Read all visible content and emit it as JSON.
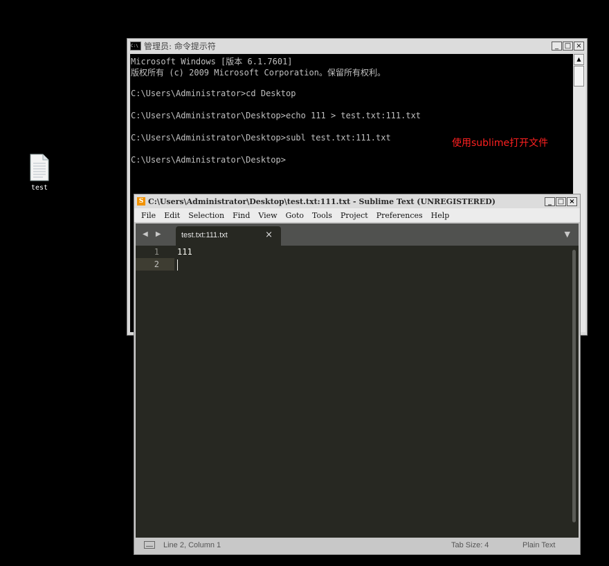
{
  "desktop": {
    "icon_label": "test"
  },
  "cmd": {
    "title": "管理员: 命令提示符",
    "icon_text": "C:\\",
    "lines": [
      "Microsoft Windows [版本 6.1.7601]",
      "版权所有 (c) 2009 Microsoft Corporation。保留所有权利。",
      "",
      "C:\\Users\\Administrator>cd Desktop",
      "",
      "C:\\Users\\Administrator\\Desktop>echo 111 > test.txt:111.txt",
      "",
      "C:\\Users\\Administrator\\Desktop>subl test.txt:111.txt",
      "",
      "C:\\Users\\Administrator\\Desktop>"
    ],
    "annotation": "使用sublime打开文件",
    "annotation_color": "#ff2020",
    "buttons": {
      "minimize": "_",
      "maximize": "□",
      "close": "×"
    },
    "scroll_up": "▲"
  },
  "sublime": {
    "title": "C:\\Users\\Administrator\\Desktop\\test.txt:111.txt - Sublime Text (UNREGISTERED)",
    "icon_glyph": "S",
    "buttons": {
      "minimize": "_",
      "maximize": "□",
      "close": "×"
    },
    "menu": [
      "File",
      "Edit",
      "Selection",
      "Find",
      "View",
      "Goto",
      "Tools",
      "Project",
      "Preferences",
      "Help"
    ],
    "tab_nav": "◀ ▶",
    "tab": {
      "label": "test.txt:111.txt",
      "close": "×"
    },
    "tab_dropdown": "▼",
    "gutter": [
      "1",
      "2"
    ],
    "code": [
      "111",
      ""
    ],
    "status": {
      "position": "Line 2, Column 1",
      "tab_size": "Tab Size: 4",
      "syntax": "Plain Text"
    },
    "colors": {
      "editor_bg": "#272822",
      "tabbar_bg": "#50514f",
      "accent": "#f29300"
    }
  }
}
